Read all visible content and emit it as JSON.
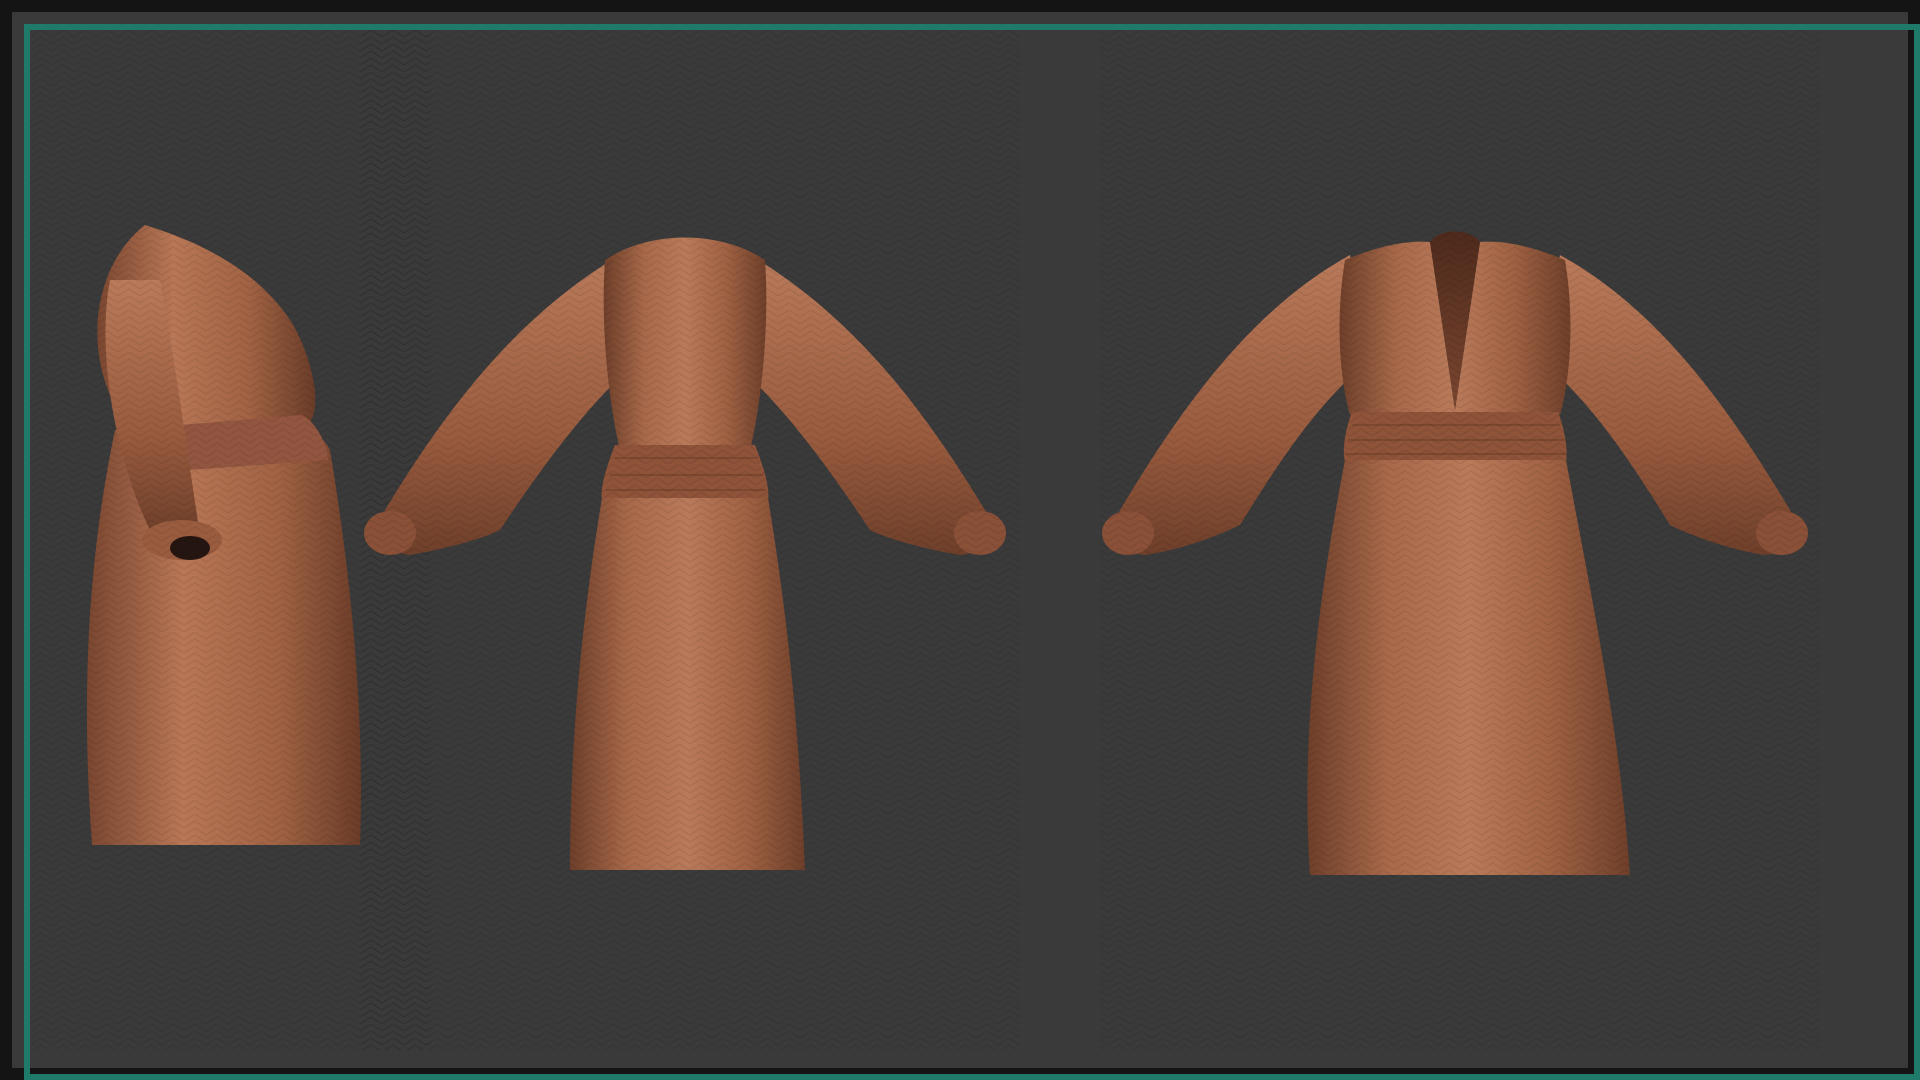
{
  "scene": {
    "background_color": "#3a3a3a",
    "frame_color": "#1f7a6a",
    "outer_border_color": "#141414",
    "fabric_base_color": "#a8694a",
    "fabric_shadow_color": "#6e3f2a",
    "fabric_highlight_color": "#c9876a",
    "views": [
      {
        "name": "side-view",
        "icon": "dress-side-icon"
      },
      {
        "name": "back-view",
        "icon": "dress-back-icon"
      },
      {
        "name": "front-view",
        "icon": "dress-front-icon"
      }
    ]
  }
}
